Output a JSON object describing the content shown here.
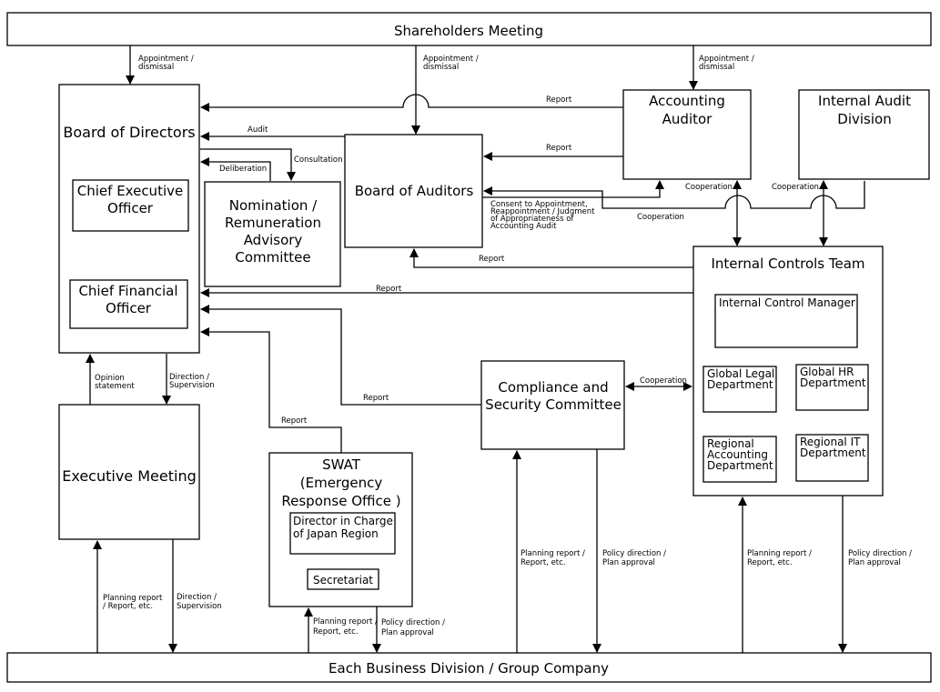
{
  "nodes": {
    "shareholders": "Shareholders Meeting",
    "board_directors": "Board of Directors",
    "ceo": [
      "Chief Executive",
      "Officer"
    ],
    "cfo": [
      "Chief Financial",
      "Officer"
    ],
    "nomination": [
      "Nomination /",
      "Remuneration",
      "Advisory",
      "Committee"
    ],
    "board_auditors": "Board of Auditors",
    "accounting_auditor": [
      "Accounting",
      "Auditor"
    ],
    "internal_audit": [
      "Internal Audit",
      "Division"
    ],
    "internal_controls": "Internal Controls Team",
    "ic_manager": "Internal Control Manager",
    "global_legal": [
      "Global Legal",
      "Department"
    ],
    "global_hr": [
      "Global HR",
      "Department"
    ],
    "regional_accounting": [
      "Regional",
      "Accounting",
      "Department"
    ],
    "regional_it": [
      "Regional IT",
      "Department"
    ],
    "compliance": [
      "Compliance and",
      "Security Committee"
    ],
    "executive": "Executive Meeting",
    "swat": [
      "SWAT",
      "(Emergency",
      "Response Office )"
    ],
    "director_japan": [
      "Director in Charge",
      "of Japan Region"
    ],
    "secretariat": "Secretariat",
    "business": "Each Business Division / Group Company"
  },
  "edges": {
    "appointment": [
      "Appointment /",
      "dismissal"
    ],
    "report": "Report",
    "audit": "Audit",
    "consultation": "Consultation",
    "deliberation": "Deliberation",
    "consent": [
      "Consent to Appointment,",
      "Reappointment / Judgment",
      "of Appropriateness of",
      "Accounting Audit"
    ],
    "cooperation": "Cooperation",
    "opinion": [
      "Opinion",
      "statement"
    ],
    "direction": [
      "Direction /",
      "Supervision"
    ],
    "planning_exec": [
      "Planning report",
      "/ Report, etc."
    ],
    "planning": [
      "Planning report /",
      "Report, etc."
    ],
    "policy": [
      "Policy direction /",
      "Plan approval"
    ]
  }
}
